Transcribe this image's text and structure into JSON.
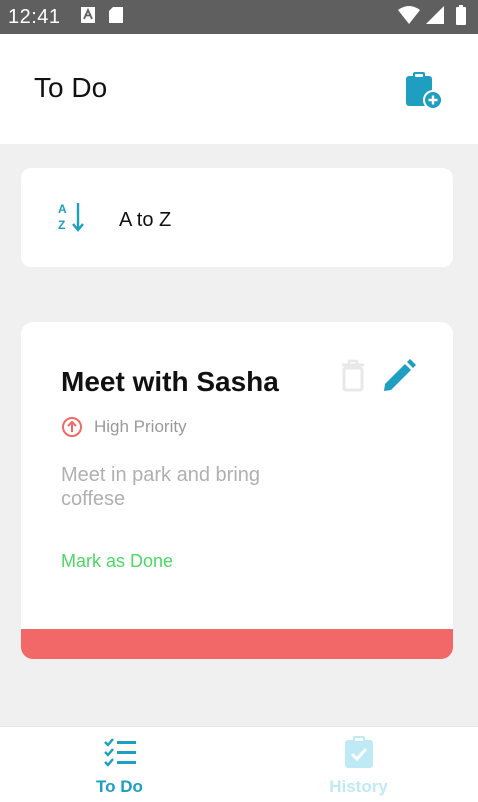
{
  "status_bar": {
    "time": "12:41"
  },
  "header": {
    "title": "To Do"
  },
  "sort": {
    "label": "A to Z"
  },
  "task": {
    "title": "Meet with Sasha",
    "priority": "High Priority",
    "description": "Meet in park and bring coffese",
    "action_label": "Mark as Done"
  },
  "nav": {
    "todo_label": "To Do",
    "history_label": "History"
  },
  "colors": {
    "accent": "#1e9ec0",
    "priority_high": "#f26868",
    "done_green": "#4cd964",
    "inactive_tab": "#bfeaf5"
  }
}
